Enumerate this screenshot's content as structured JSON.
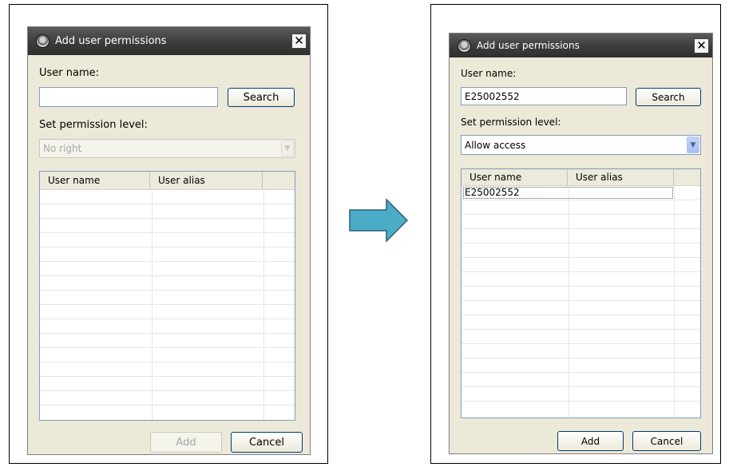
{
  "before": {
    "dialog": {
      "title": "Add user permissions",
      "close_label": "✕",
      "user_name_label": "User name:",
      "user_name_value": "",
      "search_label": "Search",
      "permission_label": "Set permission level:",
      "permission_selected": "No right",
      "permission_enabled": false,
      "columns": [
        "User name",
        "User alias"
      ],
      "rows": [],
      "add_label": "Add",
      "add_enabled": false,
      "cancel_label": "Cancel"
    }
  },
  "after": {
    "dialog": {
      "title": "Add user permissions",
      "close_label": "✕",
      "user_name_label": "User name:",
      "user_name_value": "E25002552",
      "search_label": "Search",
      "permission_label": "Set permission level:",
      "permission_selected": "Allow access",
      "permission_enabled": true,
      "columns": [
        "User name",
        "User alias"
      ],
      "rows": [
        {
          "user_name": "E25002552",
          "user_alias": ""
        }
      ],
      "add_label": "Add",
      "add_enabled": true,
      "cancel_label": "Cancel"
    }
  },
  "transition_arrow": {
    "icon": "right-arrow-icon",
    "fill": "#4bacc6",
    "stroke": "#2c5d73"
  }
}
